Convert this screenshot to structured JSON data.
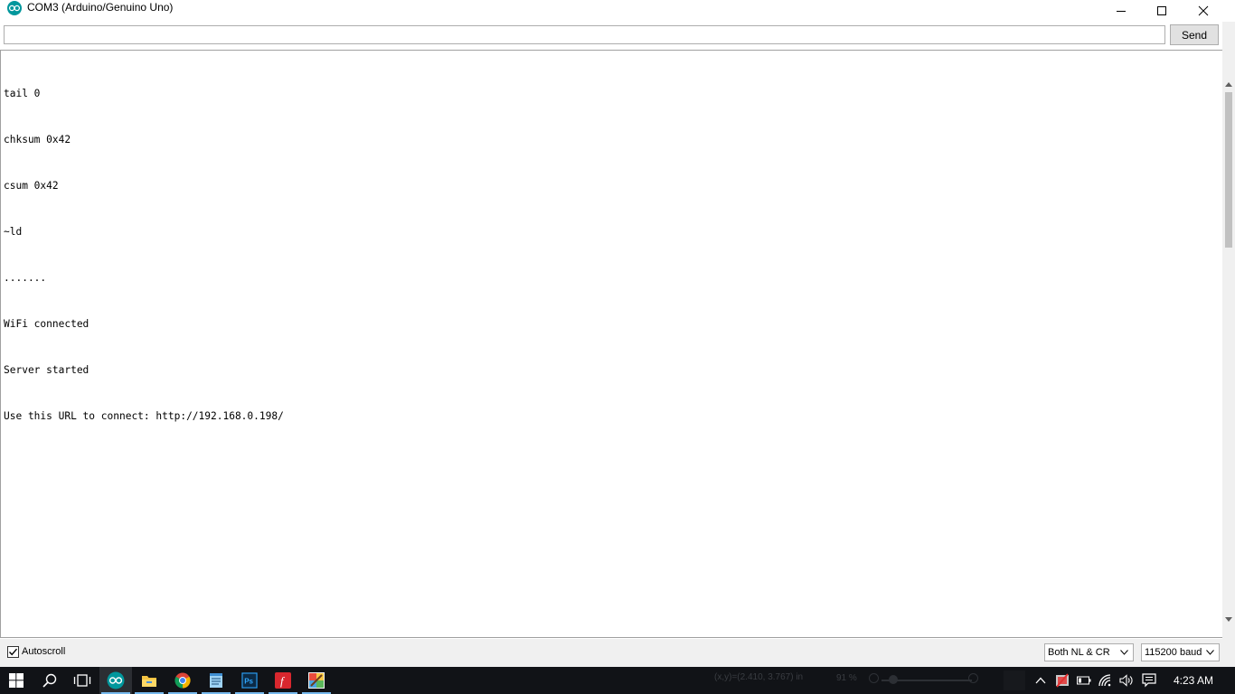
{
  "window": {
    "title": "COM3 (Arduino/Genuino Uno)"
  },
  "input": {
    "value": "",
    "send_label": "Send"
  },
  "output": {
    "lines": [
      "tail 0",
      "chksum 0x42",
      "csum 0x42",
      "~ld",
      ".......",
      "WiFi connected",
      "Server started",
      "Use this URL to connect: http://192.168.0.198/"
    ]
  },
  "footer": {
    "autoscroll_label": "Autoscroll",
    "autoscroll_checked": true,
    "line_ending": "Both NL & CR",
    "baud_rate": "115200 baud"
  },
  "background_app": {
    "coordinate_readout": "(x,y)=(2.410, 3.767) in",
    "zoom": "91 %"
  },
  "taskbar": {
    "items": [
      "windows-start",
      "search",
      "task-view",
      "arduino",
      "file-explorer",
      "chrome",
      "notepad",
      "photoshop",
      "foxit-reader",
      "paint"
    ],
    "clock": "4:23 AM"
  },
  "colors": {
    "arduino_teal": "#00979c",
    "taskbar_bg": "#111317",
    "taskbar_accent": "#76b9ed"
  }
}
